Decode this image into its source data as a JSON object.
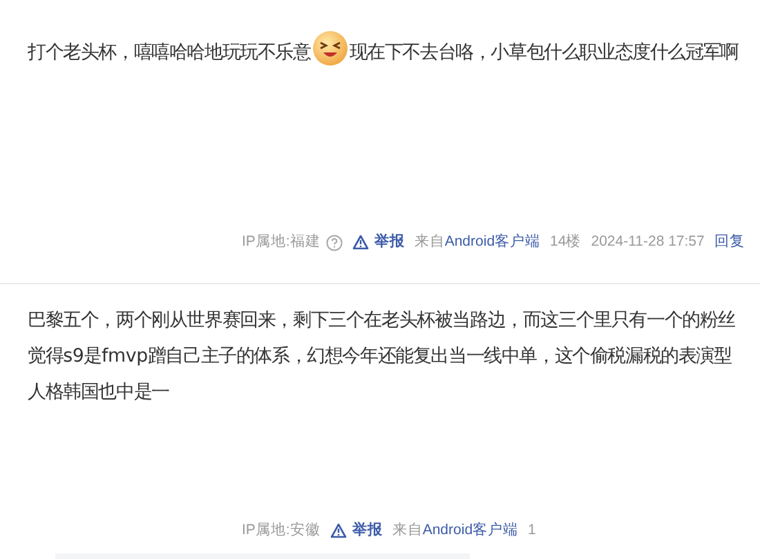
{
  "posts": [
    {
      "segments": [
        {
          "kind": "text",
          "text": "打个老头杯，嘻嘻哈哈地玩玩不乐意"
        },
        {
          "kind": "emoji"
        },
        {
          "kind": "text",
          "text": "现在下不去台咯，小草包什么职业态度什么冠军啊"
        }
      ],
      "footer": {
        "ip": "IP属地:福建",
        "help_icon": true,
        "report": "举报",
        "source_prefix": "来自",
        "source_link": "Android客户端",
        "floor": "14楼",
        "time": "2024-11-28 17:57",
        "reply": "回复"
      }
    },
    {
      "segments": [
        {
          "kind": "text",
          "text": "巴黎五个，两个刚从世界赛回来，剩下三个在老头杯被当路边，而这三个里只有一个的粉丝觉得s9是fmvp蹭自己主子的体系，幻想今年还能复出当一线中单，这个偷税漏税的表演型人格韩国也中是一"
        }
      ],
      "footer": {
        "ip": "IP属地:安徽",
        "help_icon": false,
        "report": "举报",
        "source_prefix": "来自",
        "source_link": "Android客户端",
        "floor": "1"
      }
    }
  ]
}
